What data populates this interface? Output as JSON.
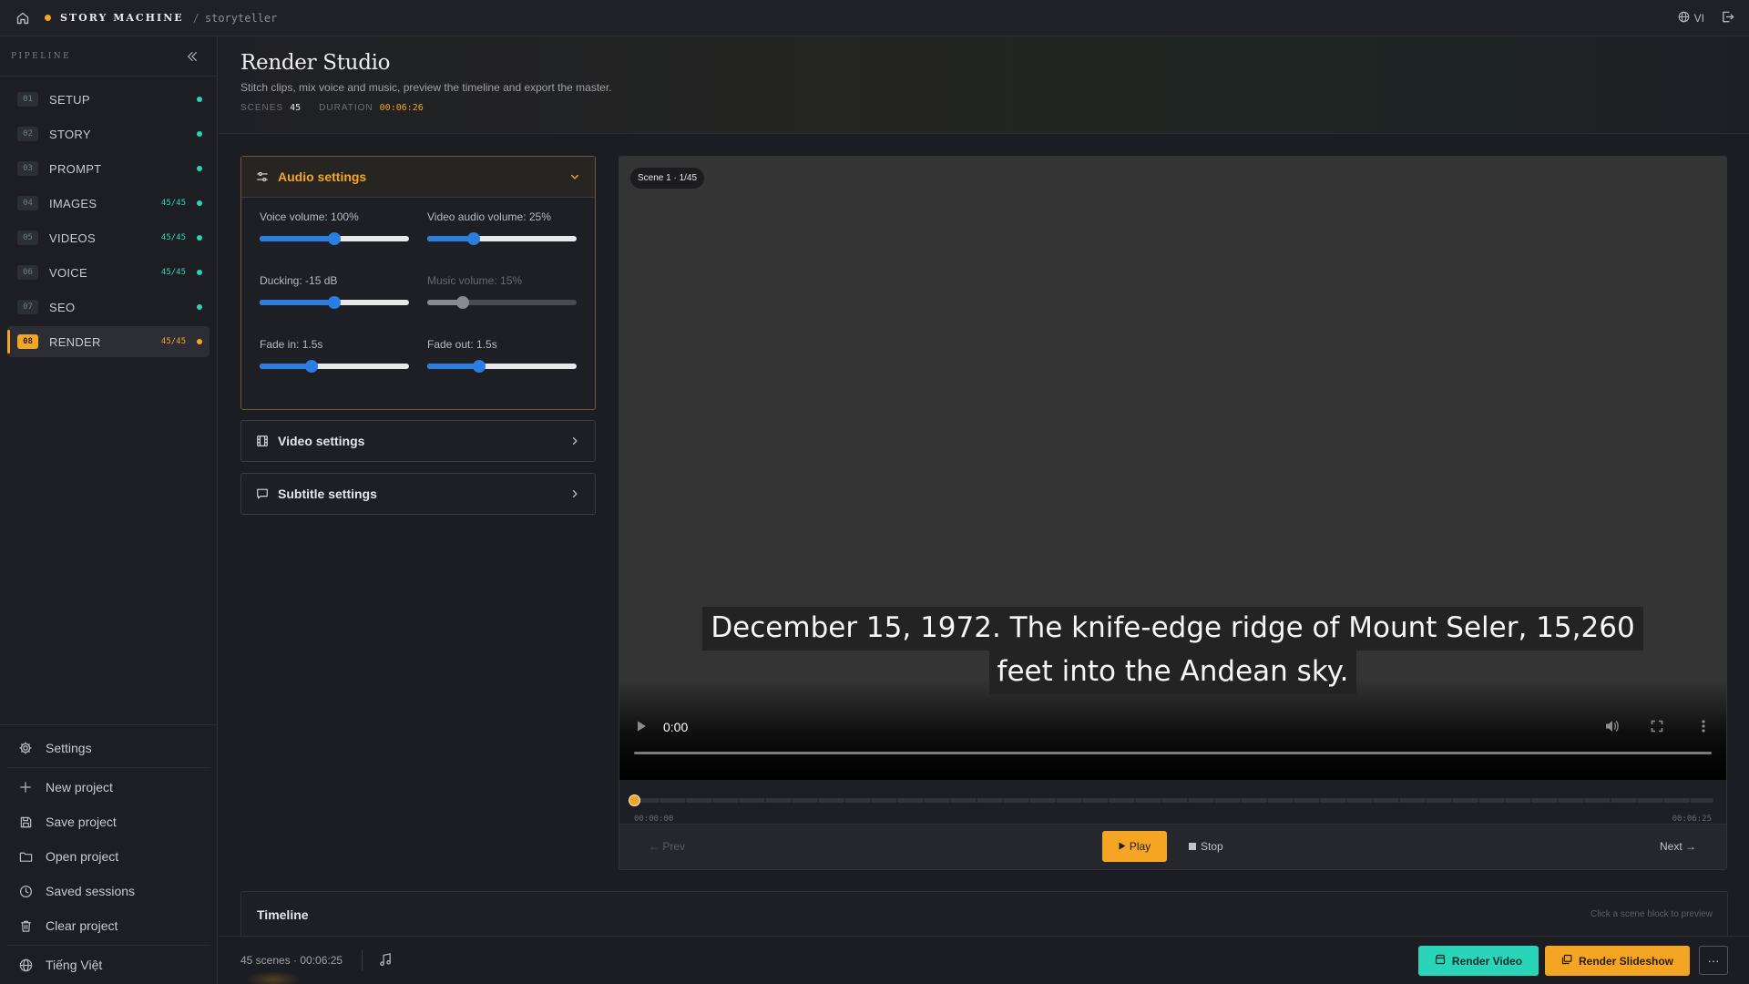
{
  "topbar": {
    "brand": "STORY MACHINE",
    "separator": "/",
    "crumb": "storyteller",
    "lang": "VI",
    "accent": "#f5a524"
  },
  "sidebar": {
    "title": "PIPELINE",
    "steps": [
      {
        "num": "01",
        "label": "SETUP",
        "count": "",
        "status": "done"
      },
      {
        "num": "02",
        "label": "STORY",
        "count": "",
        "status": "done"
      },
      {
        "num": "03",
        "label": "PROMPT",
        "count": "",
        "status": "done"
      },
      {
        "num": "04",
        "label": "IMAGES",
        "count": "45/45",
        "status": "done"
      },
      {
        "num": "05",
        "label": "VIDEOS",
        "count": "45/45",
        "status": "done"
      },
      {
        "num": "06",
        "label": "VOICE",
        "count": "45/45",
        "status": "done"
      },
      {
        "num": "07",
        "label": "SEO",
        "count": "",
        "status": "done"
      },
      {
        "num": "08",
        "label": "RENDER",
        "count": "45/45",
        "status": "active"
      }
    ],
    "bottom": {
      "settings": "Settings",
      "new_project": "New project",
      "save_project": "Save project",
      "open_project": "Open project",
      "saved_sessions": "Saved sessions",
      "clear_project": "Clear project",
      "language": "Tiếng Việt"
    }
  },
  "header": {
    "title": "Render Studio",
    "subtitle": "Stitch clips, mix voice and music, preview the timeline and export the master.",
    "scenes_label": "SCENES",
    "scenes_value": "45",
    "duration_label": "DURATION",
    "duration_value": "00:06:26"
  },
  "audio": {
    "title": "Audio settings",
    "sliders": [
      {
        "label": "Voice volume: 100%",
        "fraction": 0.5,
        "disabled": false
      },
      {
        "label": "Video audio volume: 25%",
        "fraction": 0.31,
        "disabled": false
      },
      {
        "label": "Ducking: -15 dB",
        "fraction": 0.5,
        "disabled": false
      },
      {
        "label": "Music volume: 15%",
        "fraction": 0.24,
        "disabled": true
      },
      {
        "label": "Fade in: 1.5s",
        "fraction": 0.35,
        "disabled": false
      },
      {
        "label": "Fade out: 1.5s",
        "fraction": 0.35,
        "disabled": false
      }
    ]
  },
  "video_settings": {
    "title": "Video settings"
  },
  "subtitle_settings": {
    "title": "Subtitle settings"
  },
  "preview": {
    "scene_tag": "Scene 1 · 1/45",
    "caption_line1": "December 15, 1972. The knife-edge ridge of Mount Seler, 15,260",
    "caption_line2": "feet into the Andean sky.",
    "player_time": "0:00",
    "time_start": "00:00:00",
    "time_end": "00:06:25",
    "prev": "← Prev",
    "play": "Play",
    "stop": "Stop",
    "next": "Next →"
  },
  "timeline": {
    "title": "Timeline",
    "hint": "Click a scene block to preview"
  },
  "bottombar": {
    "stats": "45 scenes · 00:06:25",
    "render_video": "Render Video",
    "render_slideshow": "Render Slideshow",
    "more": "···",
    "teal": "#2ad4b8"
  }
}
